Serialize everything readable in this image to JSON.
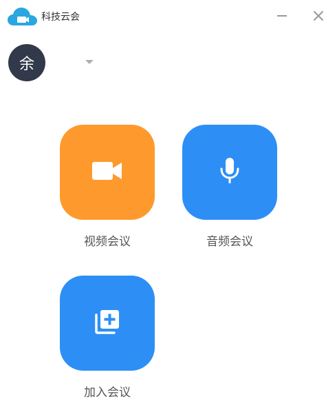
{
  "app": {
    "title": "科技云会",
    "logo_icon": "cloud-camera-logo",
    "brand_color": "#2aa7e0"
  },
  "window_controls": {
    "minimize_icon": "minimize-icon",
    "close_icon": "close-icon"
  },
  "user": {
    "avatar_text": "余",
    "avatar_color": "#31394a",
    "dropdown_icon": "caret-down-icon"
  },
  "actions": [
    {
      "label": "视频会议",
      "icon": "video-camera-icon",
      "color": "#fe9a2d"
    },
    {
      "label": "音频会议",
      "icon": "microphone-icon",
      "color": "#2d8ff5"
    },
    {
      "label": "加入会议",
      "icon": "add-to-stack-icon",
      "color": "#2d8ff5"
    }
  ]
}
